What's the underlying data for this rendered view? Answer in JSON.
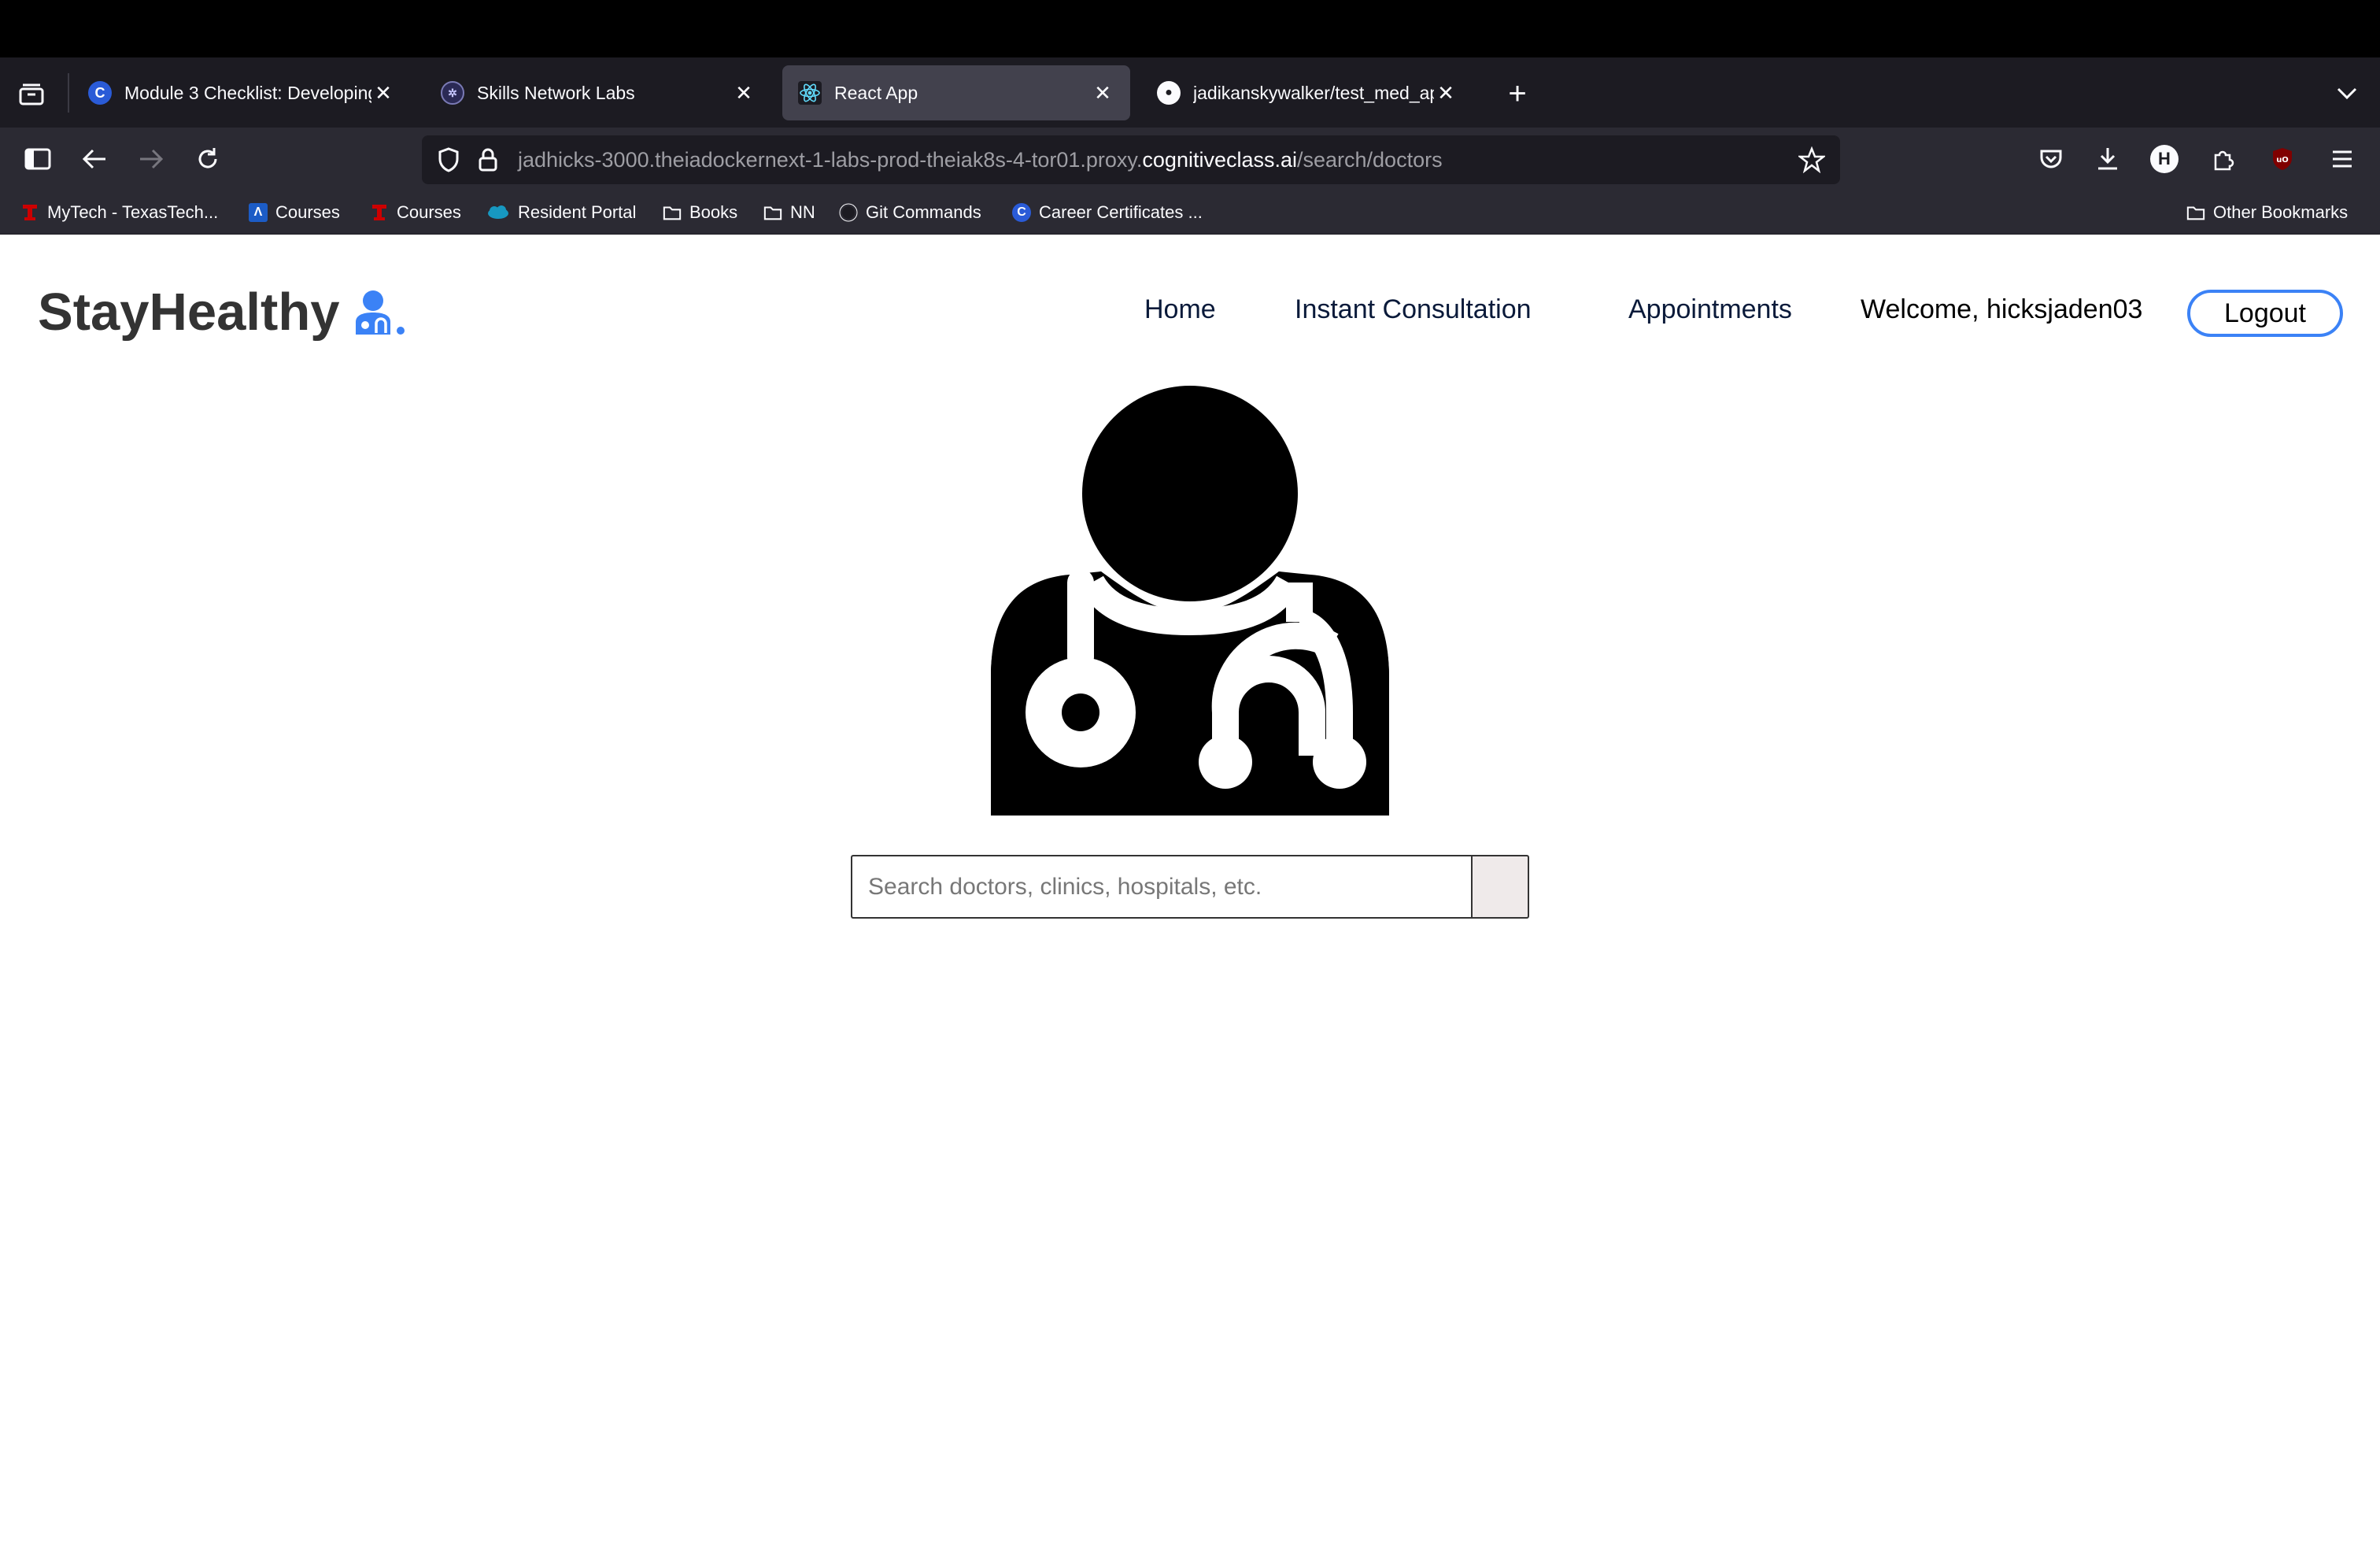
{
  "browser": {
    "tabs": [
      {
        "label": "Module 3 Checklist: Developing",
        "icon": "coursera-icon",
        "active": false
      },
      {
        "label": "Skills Network Labs",
        "icon": "skills-network-icon",
        "active": false
      },
      {
        "label": "React App",
        "icon": "react-icon",
        "active": true
      },
      {
        "label": "jadikanskywalker/test_med_app",
        "icon": "github-icon",
        "active": false
      }
    ],
    "url": {
      "prefix": "jadhicks-3000.theiadockernext-1-labs-prod-theiak8s-4-tor01.proxy.",
      "host": "cognitiveclass.ai",
      "path": "/search/doctors"
    },
    "profile_initial": "H",
    "bookmarks": [
      {
        "label": "MyTech - TexasTech...",
        "icon": "texas-tech-icon"
      },
      {
        "label": "Courses",
        "icon": "canvas-icon"
      },
      {
        "label": "Courses",
        "icon": "texas-tech-icon"
      },
      {
        "label": "Resident Portal",
        "icon": "salesforce-icon"
      },
      {
        "label": "Books",
        "icon": "folder-icon"
      },
      {
        "label": "NN",
        "icon": "folder-icon"
      },
      {
        "label": "Git Commands",
        "icon": "github-icon"
      },
      {
        "label": "Career Certificates ...",
        "icon": "coursera-icon"
      }
    ],
    "other_bookmarks": "Other Bookmarks"
  },
  "site": {
    "brand": "StayHealthy",
    "nav": {
      "home": "Home",
      "instant_consultation": "Instant Consultation",
      "appointments": "Appointments"
    },
    "welcome": "Welcome, hicksjaden03",
    "logout": "Logout",
    "accent_color": "#3b82f6"
  },
  "search": {
    "placeholder": "Search doctors, clinics, hospitals, etc.",
    "value": ""
  }
}
